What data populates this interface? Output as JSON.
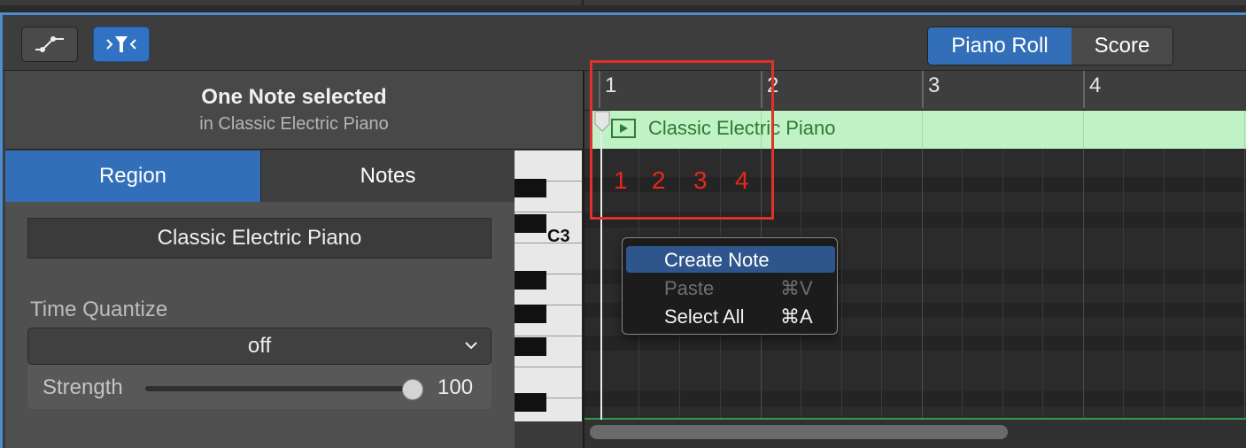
{
  "toolbar": {
    "automation_icon": "automation-curve-icon",
    "midi_filter_icon": "midi-filter-icon",
    "view_tabs": [
      {
        "label": "Piano Roll",
        "selected": true
      },
      {
        "label": "Score",
        "selected": false
      }
    ]
  },
  "inspector": {
    "title": "One Note selected",
    "subtitle": "in Classic Electric Piano",
    "tabs": [
      {
        "label": "Region",
        "selected": true
      },
      {
        "label": "Notes",
        "selected": false
      }
    ],
    "region_name": "Classic Electric Piano",
    "time_quantize_label": "Time Quantize",
    "time_quantize_value": "off",
    "strength_label": "Strength",
    "strength_value": "100",
    "strength_fraction": 1.0
  },
  "editor": {
    "ruler_bars": [
      "1",
      "2",
      "3",
      "4"
    ],
    "region_name": "Classic Electric Piano",
    "keyboard_label": "C3",
    "annotation_numbers": [
      "1",
      "2",
      "3",
      "4"
    ]
  },
  "context_menu": {
    "items": [
      {
        "label": "Create Note",
        "shortcut": "",
        "state": "highlighted"
      },
      {
        "label": "Paste",
        "shortcut": "⌘V",
        "state": "disabled"
      },
      {
        "label": "Select All",
        "shortcut": "⌘A",
        "state": "enabled"
      }
    ]
  },
  "colors": {
    "accent": "#336fb8",
    "region_fill": "#c1f2c5",
    "region_text": "#2b7a34",
    "annotation_red": "#e0322a"
  }
}
